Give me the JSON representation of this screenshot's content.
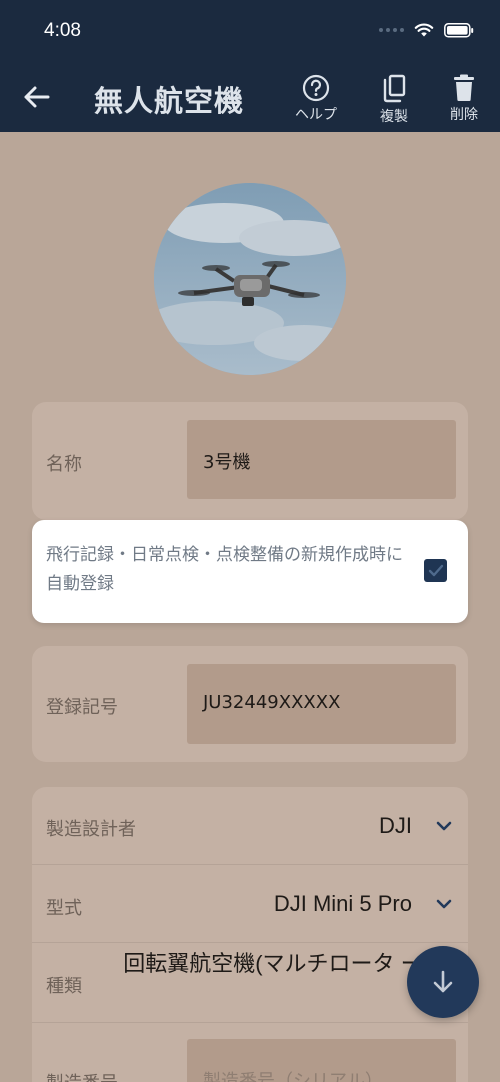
{
  "status_bar": {
    "time": "4:08"
  },
  "app_bar": {
    "title": "無人航空機",
    "actions": {
      "help": "ヘルプ",
      "copy": "複製",
      "delete": "削除"
    }
  },
  "name_field": {
    "label": "名称",
    "value": "3号機"
  },
  "auto_register": {
    "text": "飛行記録・日常点検・点検整備の新規作成時に自動登録",
    "checked": true
  },
  "registration": {
    "label": "登録記号",
    "value": "JU32449XXXXX"
  },
  "spec": {
    "manufacturer": {
      "label": "製造設計者",
      "value": "DJI"
    },
    "model": {
      "label": "型式",
      "value": "DJI Mini 5 Pro"
    },
    "type": {
      "label": "種類",
      "value": "回転翼航空機(マルチロータ ー)"
    },
    "serial": {
      "label": "製造番号",
      "placeholder": "製造番号（シリアル）"
    }
  },
  "colors": {
    "app_bar": "#1b2a3f",
    "overlay": "#b9a698",
    "accent": "#1f3553"
  }
}
